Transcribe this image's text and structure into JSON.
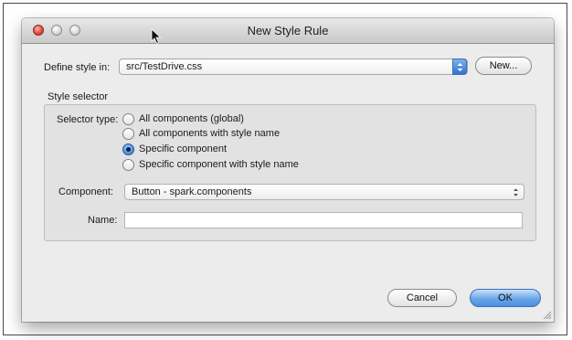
{
  "window": {
    "title": "New Style Rule"
  },
  "define_style": {
    "label": "Define style in:",
    "value": "src/TestDrive.css",
    "new_button": "New..."
  },
  "style_selector": {
    "section_label": "Style selector",
    "selector_type_label": "Selector type:",
    "options": [
      {
        "label": "All components (global)",
        "selected": false
      },
      {
        "label": "All components with style name",
        "selected": false
      },
      {
        "label": "Specific component",
        "selected": true
      },
      {
        "label": "Specific component with style name",
        "selected": false
      }
    ],
    "component_label": "Component:",
    "component_value": "Button - spark.components",
    "name_label": "Name:",
    "name_value": ""
  },
  "buttons": {
    "cancel": "Cancel",
    "ok": "OK"
  },
  "colors": {
    "accent": "#4a8fe0",
    "close": "#e24c3e"
  }
}
